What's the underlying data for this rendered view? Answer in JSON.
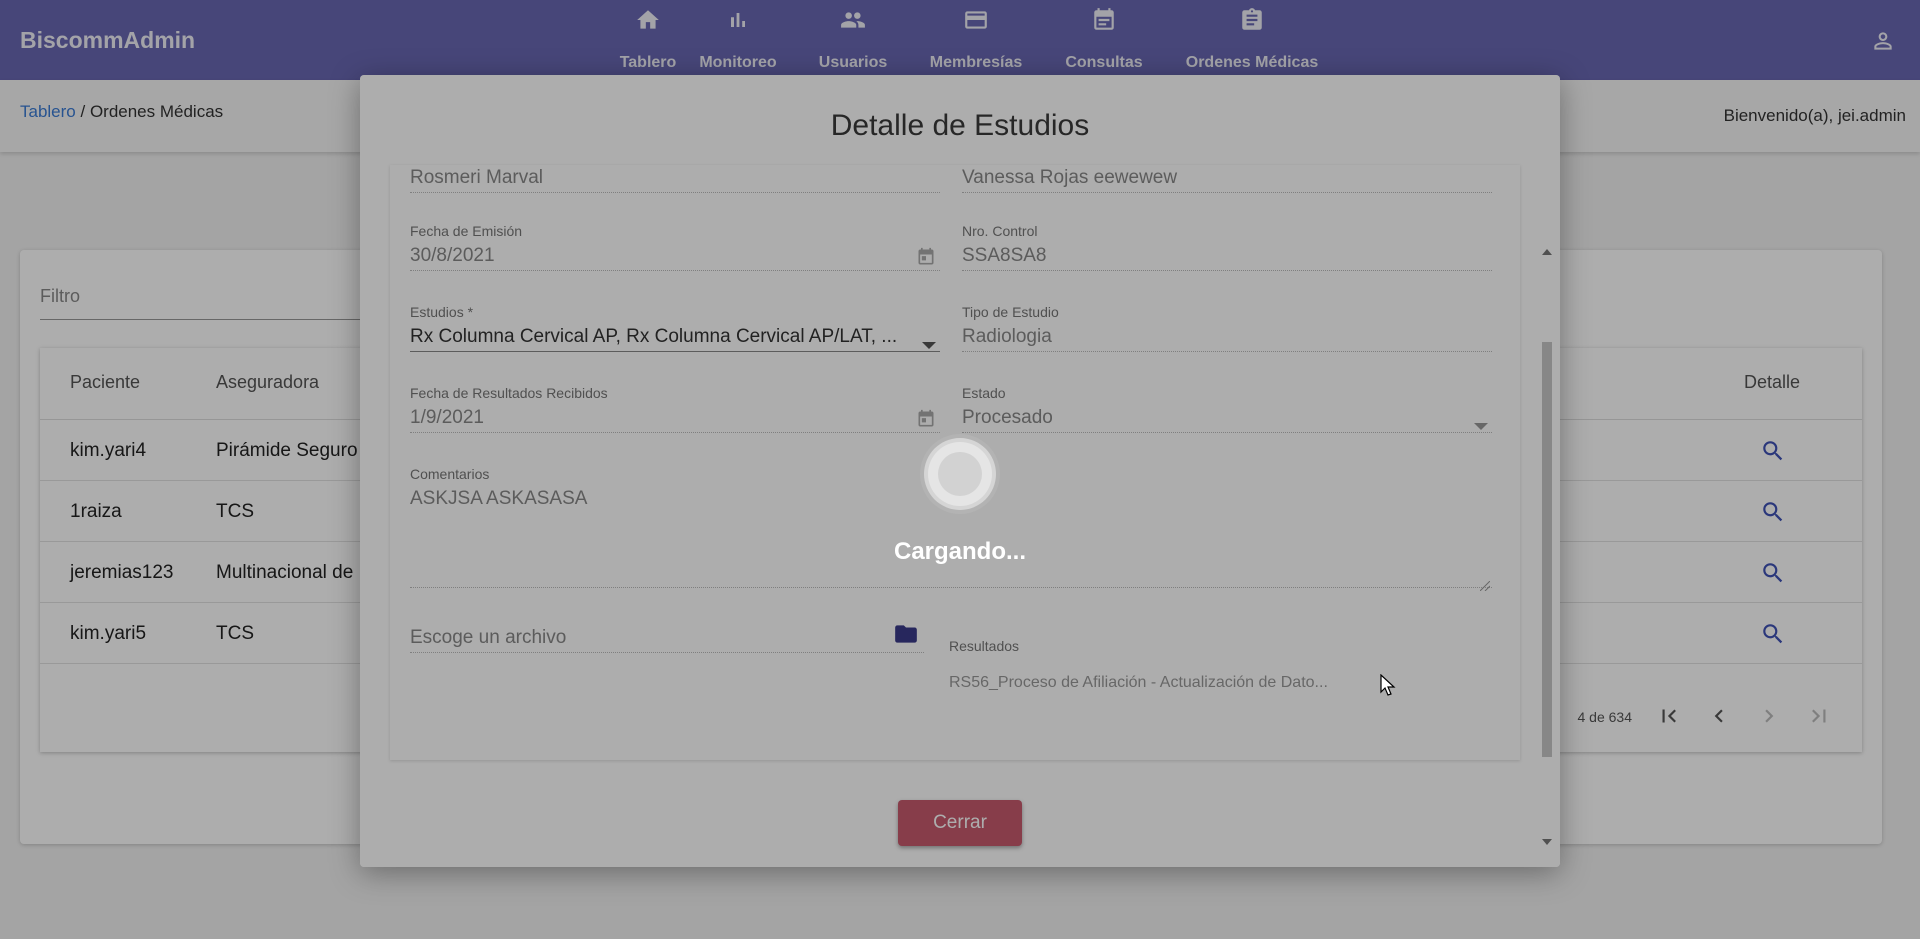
{
  "app": {
    "title": "BiscommAdmin"
  },
  "nav": [
    {
      "label": "Tablero",
      "icon": "home-icon"
    },
    {
      "label": "Monitoreo",
      "icon": "bar-chart-icon"
    },
    {
      "label": "Usuarios",
      "icon": "people-icon"
    },
    {
      "label": "Membresías",
      "icon": "credit-card-icon"
    },
    {
      "label": "Consultas",
      "icon": "calendar-icon"
    },
    {
      "label": "Ordenes Médicas",
      "icon": "clipboard-icon"
    }
  ],
  "breadcrumb": {
    "home": "Tablero",
    "separator": " / ",
    "current": "Ordenes Médicas"
  },
  "welcome": "Bienvenido(a), jei.admin",
  "list": {
    "filter_placeholder": "Filtro",
    "columns": [
      "Paciente",
      "Aseguradora",
      "Detalle"
    ],
    "rows": [
      {
        "paciente": "kim.yari4",
        "aseguradora": "Pirámide Seguro"
      },
      {
        "paciente": "1raiza",
        "aseguradora": "TCS"
      },
      {
        "paciente": "jeremias123",
        "aseguradora": "Multinacional de"
      },
      {
        "paciente": "kim.yari5",
        "aseguradora": "TCS"
      }
    ],
    "paginator_range": "4 de 634"
  },
  "modal": {
    "title": "Detalle de Estudios",
    "fields": {
      "patient_name": "Rosmeri Marval",
      "doctor_name": "Vanessa Rojas eewewew",
      "fecha_emision_label": "Fecha de Emisión",
      "fecha_emision": "30/8/2021",
      "nro_control_label": "Nro. Control",
      "nro_control": "SSA8SA8",
      "estudios_label": "Estudios *",
      "estudios": "Rx Columna Cervical AP, Rx Columna Cervical AP/LAT, ...",
      "tipo_estudio_label": "Tipo de Estudio",
      "tipo_estudio": "Radiologia",
      "fecha_resultados_label": "Fecha de Resultados Recibidos",
      "fecha_resultados": "1/9/2021",
      "estado_label": "Estado",
      "estado": "Procesado",
      "comentarios_label": "Comentarios",
      "comentarios": "ASKJSA ASKASASA",
      "archivo_placeholder": "Escoge un archivo",
      "resultados_label": "Resultados",
      "resultados": "RS56_Proceso de Afiliación - Actualización de Dato..."
    },
    "close_label": "Cerrar"
  },
  "loading": {
    "text": "Cargando..."
  },
  "colors": {
    "toolbar": "#6967b3",
    "close_button": "#c75a6e",
    "link": "#3a7bd5"
  }
}
